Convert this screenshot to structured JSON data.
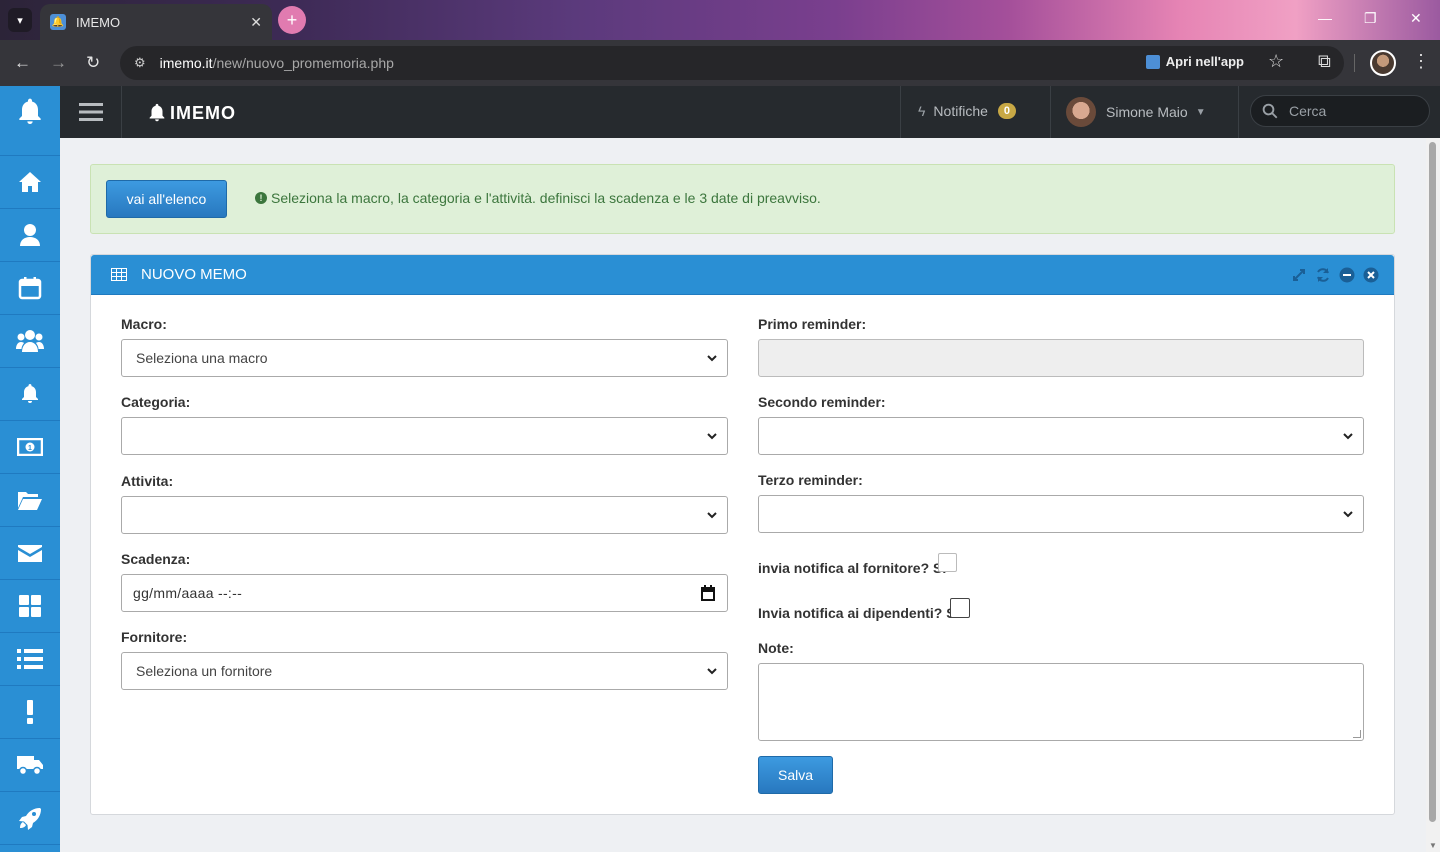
{
  "browser": {
    "tab_title": "IMEMO",
    "url_host": "imemo.it",
    "url_path": "/new/nuovo_promemoria.php",
    "open_in_app": "Apri nell'app"
  },
  "header": {
    "brand": "IMEMO",
    "notifications_label": "Notifiche",
    "notifications_count": "0",
    "user_name": "Simone Maio",
    "search_placeholder": "Cerca"
  },
  "sidebar": {
    "items": [
      {
        "icon": "home-icon"
      },
      {
        "icon": "user-icon"
      },
      {
        "icon": "calendar-icon"
      },
      {
        "icon": "users-icon"
      },
      {
        "icon": "bell-icon"
      },
      {
        "icon": "money-icon"
      },
      {
        "icon": "folder-open-icon"
      },
      {
        "icon": "envelope-icon"
      },
      {
        "icon": "dashboard-icon"
      },
      {
        "icon": "list-icon"
      },
      {
        "icon": "exclamation-icon"
      },
      {
        "icon": "truck-icon"
      },
      {
        "icon": "rocket-icon"
      }
    ]
  },
  "alert": {
    "button_label": "vai all'elenco",
    "message": "Seleziona la macro, la categoria e l'attività. definisci la scadenza e le 3 date di preavviso."
  },
  "panel": {
    "title": "NUOVO MEMO"
  },
  "form": {
    "macro_label": "Macro:",
    "macro_value": "Seleziona una macro",
    "categoria_label": "Categoria:",
    "categoria_value": "",
    "attivita_label": "Attivita:",
    "attivita_value": "",
    "scadenza_label": "Scadenza:",
    "scadenza_placeholder": "gg/mm/aaaa --:--",
    "fornitore_label": "Fornitore:",
    "fornitore_value": "Seleziona un fornitore",
    "primo_label": "Primo reminder:",
    "secondo_label": "Secondo reminder:",
    "terzo_label": "Terzo reminder:",
    "notifica_fornitore_label": "invia notifica al fornitore? SI",
    "notifica_dipendenti_label": "Invia notifica ai dipendenti? SI",
    "note_label": "Note:",
    "save_label": "Salva"
  },
  "colors": {
    "accent": "#2a8fd4",
    "header_bg": "#262a2e",
    "alert_bg": "#dff0d8",
    "alert_text": "#3c763d"
  }
}
